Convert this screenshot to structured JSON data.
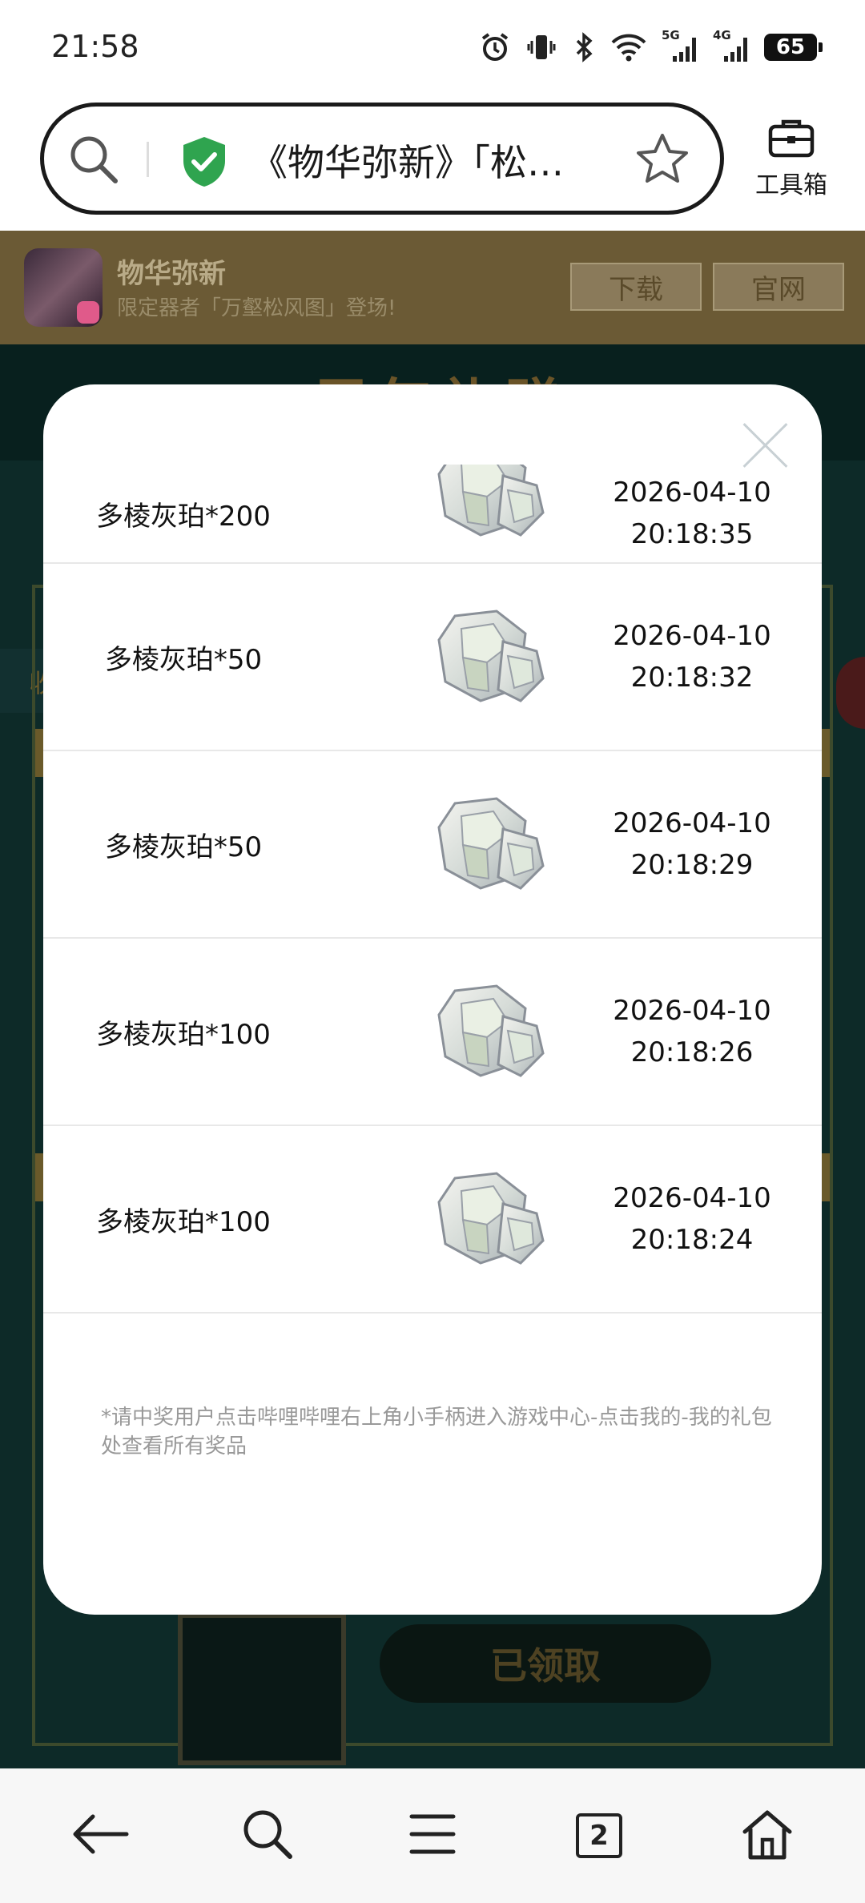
{
  "status_bar": {
    "time": "21:58",
    "battery": "65",
    "network_5g": "5G",
    "network_4g": "4G",
    "icons": [
      "alarm-icon",
      "vibrate-icon",
      "bluetooth-icon",
      "wifi-icon",
      "signal-5g-icon",
      "signal-4g-icon",
      "battery-icon"
    ]
  },
  "address_bar": {
    "url_text": "《物华弥新》「松…",
    "toolbox_label": "工具箱"
  },
  "app_banner": {
    "app_name": "物华弥新",
    "subtitle": "限定器者「万壑松风图」登场!",
    "download_label": "下载",
    "official_label": "官网"
  },
  "background_page": {
    "header_title": "周年礼赠",
    "left_tab": "收",
    "claimed_label": "已领取"
  },
  "modal": {
    "records": [
      {
        "item": "多棱灰珀*200",
        "date": "2026-04-10",
        "time": "20:18:35"
      },
      {
        "item": "多棱灰珀*50",
        "date": "2026-04-10",
        "time": "20:18:32"
      },
      {
        "item": "多棱灰珀*50",
        "date": "2026-04-10",
        "time": "20:18:29"
      },
      {
        "item": "多棱灰珀*100",
        "date": "2026-04-10",
        "time": "20:18:26"
      },
      {
        "item": "多棱灰珀*100",
        "date": "2026-04-10",
        "time": "20:18:24"
      }
    ],
    "notice": "*请中奖用户点击哔哩哔哩右上角小手柄进入游戏中心-点击我的-我的礼包处查看所有奖品"
  },
  "bottom_nav": {
    "tab_count": "2",
    "icons": [
      "back-arrow-icon",
      "search-icon",
      "menu-icon",
      "tabs-icon",
      "home-icon"
    ]
  }
}
